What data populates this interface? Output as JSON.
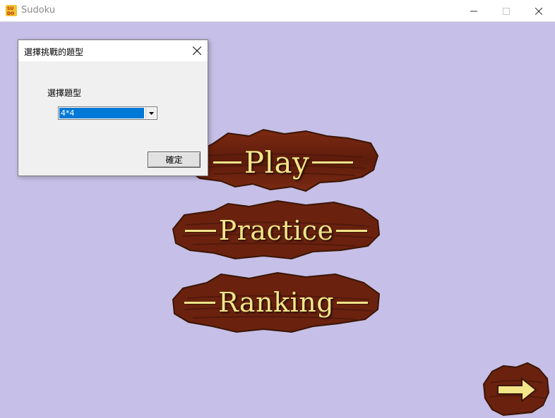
{
  "window": {
    "title": "Sudoku",
    "app_icon": "sudoku-app-icon"
  },
  "colors": {
    "background": "#c6bfe7",
    "wood": "#6e2410",
    "sign_text": "#f3e58a",
    "selection": "#0078d7"
  },
  "menu": {
    "play_label": "Play",
    "practice_label": "Practice",
    "ranking_label": "Ranking",
    "next_icon": "right-arrow-icon"
  },
  "dialog": {
    "title": "選擇挑戰的題型",
    "field_label": "選擇題型",
    "selected_value": "4*4",
    "ok_label": "確定"
  }
}
